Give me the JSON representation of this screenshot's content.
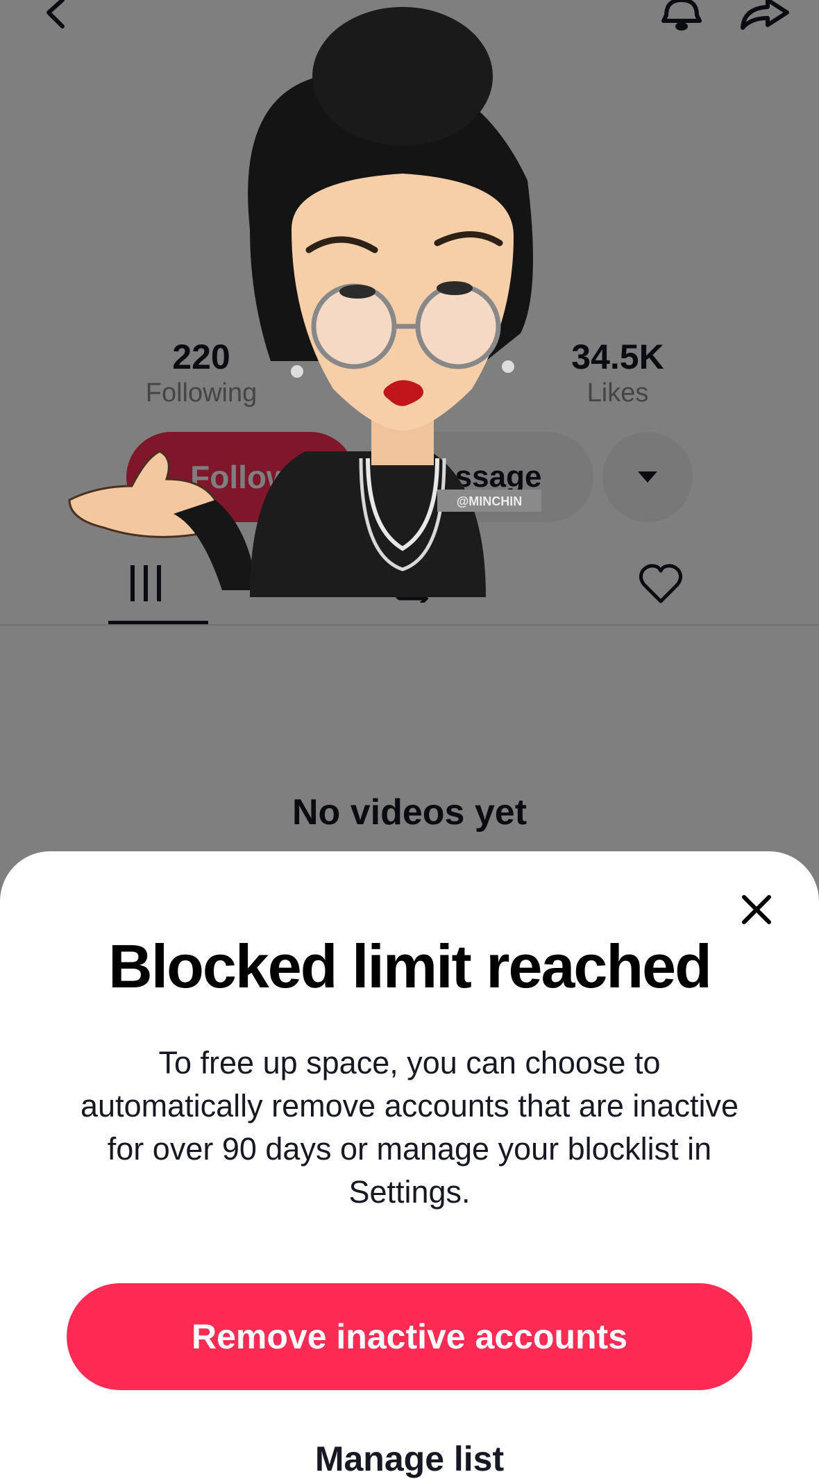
{
  "profile": {
    "stats": [
      {
        "value": "220",
        "label": "Following"
      },
      {
        "value": "34.5K",
        "label": "Likes"
      }
    ],
    "follow_label": "Follow",
    "message_label": "Message",
    "empty_state": "No videos yet",
    "avatar_watermark": "@MINCHIN",
    "tab_icons": [
      "videos-grid-icon",
      "reposts-icon",
      "liked-heart-icon"
    ]
  },
  "topbar": {
    "icons": [
      "back-chevron-icon",
      "bell-icon",
      "share-arrow-icon"
    ]
  },
  "dialog": {
    "title": "Blocked limit reached",
    "body": "To free up space, you can choose to automatically remove accounts that are inactive for over 90 days or manage your blocklist in Settings.",
    "primary_label": "Remove inactive accounts",
    "secondary_label": "Manage list",
    "close_icon": "close-icon"
  },
  "colors": {
    "accent": "#fe2c55",
    "text": "#161823",
    "muted": "#8a8b91",
    "dim_overlay": "rgba(0,0,0,0.5)"
  }
}
